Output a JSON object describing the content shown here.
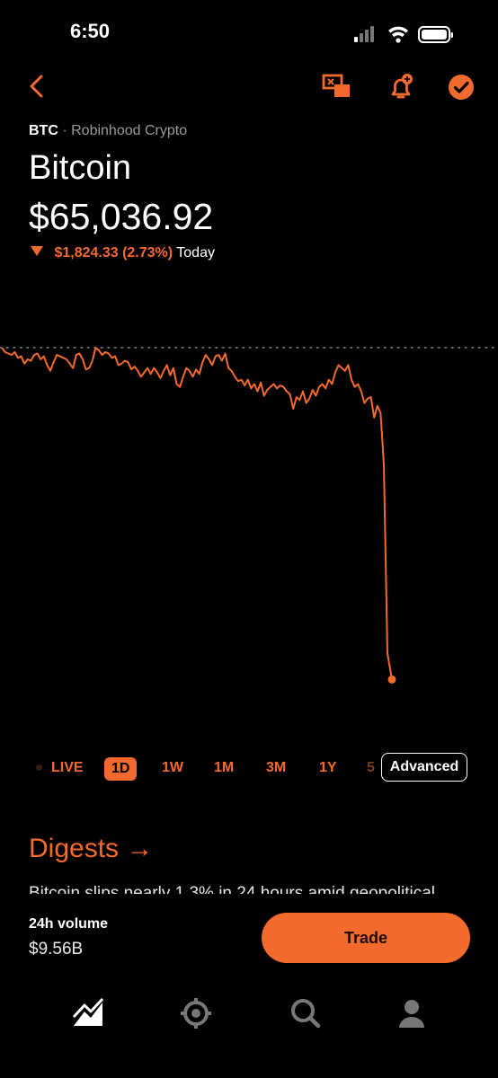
{
  "status_bar": {
    "time": "6:50"
  },
  "header": {
    "symbol": "BTC",
    "exchange": "· Robinhood Crypto",
    "name": "Bitcoin",
    "price": "$65,036.92"
  },
  "change": {
    "amount": "$1,824.33 (2.73%)",
    "period": "Today",
    "direction": "down"
  },
  "colors": {
    "accent": "#f26a2d",
    "background": "#000000"
  },
  "chart_data": {
    "type": "line",
    "series": [
      {
        "values": [
          100,
          97,
          96,
          95,
          97,
          93,
          94,
          89,
          92,
          91,
          95,
          96,
          92,
          94,
          88,
          84,
          90,
          95,
          94,
          93,
          92,
          89,
          86,
          95,
          96,
          92,
          85,
          86,
          91,
          100,
          98,
          95,
          97,
          96,
          93,
          94,
          88,
          89,
          91,
          90,
          85,
          87,
          84,
          80,
          83,
          86,
          82,
          86,
          83,
          79,
          84,
          88,
          81,
          86,
          75,
          73,
          80,
          86,
          84,
          80,
          85,
          82,
          90,
          95,
          92,
          88,
          94,
          95,
          91,
          96,
          86,
          84,
          80,
          77,
          78,
          74,
          78,
          72,
          75,
          70,
          76,
          67,
          71,
          73,
          75,
          72,
          74,
          73,
          70,
          68,
          58,
          66,
          64,
          70,
          62,
          65,
          71,
          67,
          73,
          75,
          72,
          78,
          75,
          83,
          88,
          86,
          84,
          88,
          78,
          73,
          75,
          70,
          62,
          65,
          66,
          52,
          60,
          55,
          20,
          -110,
          -128
        ]
      }
    ],
    "reference_line": "dotted",
    "xlabel": "",
    "ylabel": ""
  },
  "ranges": [
    {
      "label": "LIVE"
    },
    {
      "label": "1D",
      "active": true
    },
    {
      "label": "1W"
    },
    {
      "label": "1M"
    },
    {
      "label": "3M"
    },
    {
      "label": "1Y"
    },
    {
      "label": "5"
    }
  ],
  "advanced_label": "Advanced",
  "digests": {
    "title": "Digests →",
    "text": "Bitcoin slips nearly 1.3% in 24 hours amid geopolitical"
  },
  "footer": {
    "volume_label": "24h volume",
    "volume_value": "$9.56B",
    "trade_label": "Trade"
  },
  "tabbar": {
    "icons": [
      "chart-icon",
      "crypto-icon",
      "search-icon",
      "profile-icon"
    ]
  }
}
